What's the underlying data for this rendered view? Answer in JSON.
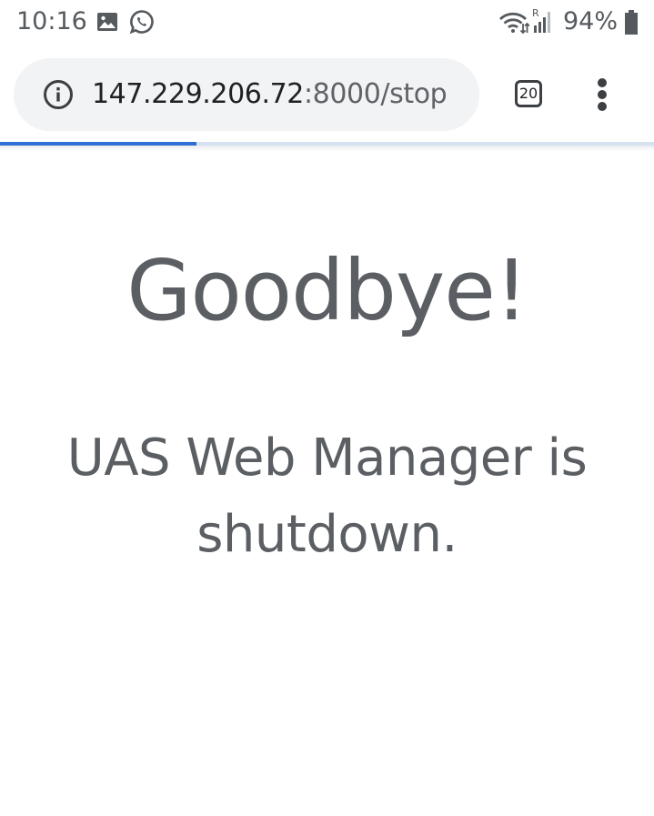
{
  "status_bar": {
    "time": "10:16",
    "battery_percent": "94%",
    "battery_level": 0.94,
    "icons": [
      "image-icon",
      "whatsapp-icon",
      "wifi-icon",
      "signal-icon",
      "battery-icon"
    ],
    "roaming_indicator": "R"
  },
  "browser": {
    "url_host": "147.229.206.72",
    "url_rest": ":8000/stop",
    "tab_count": "20",
    "page_load_progress": 0.3,
    "accent_color": "#2f6fd6"
  },
  "page": {
    "heading": "Goodbye!",
    "message": "UAS Web Manager is shutdown."
  }
}
